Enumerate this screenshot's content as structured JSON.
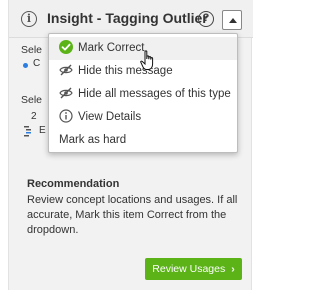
{
  "header": {
    "title": "Insight - Tagging Outlier",
    "info_icon": "i",
    "help_icon": "?"
  },
  "background_fragments": {
    "label_1": "Sele",
    "label_2": "Sele",
    "glyph_1": "2",
    "glyph_2": "E",
    "glyph_3": "C",
    "accent_color": "#2a7de1"
  },
  "menu": {
    "items": [
      {
        "label": "Mark Correct",
        "icon": "check-circle-icon",
        "icon_color": "#5bb318"
      },
      {
        "label": "Hide this message",
        "icon": "eye-slash-icon"
      },
      {
        "label": "Hide all messages of this type",
        "icon": "eye-slash-icon"
      },
      {
        "label": "View Details",
        "icon": "info-circle-icon"
      },
      {
        "label": "Mark as hard",
        "icon": ""
      }
    ]
  },
  "recommendation": {
    "title": "Recommendation",
    "text": "Review concept locations and usages. If all accurate, Mark this item Correct from the dropdown."
  },
  "review_button": {
    "label": "Review Usages",
    "chevron": "›",
    "color": "#5bb318"
  }
}
